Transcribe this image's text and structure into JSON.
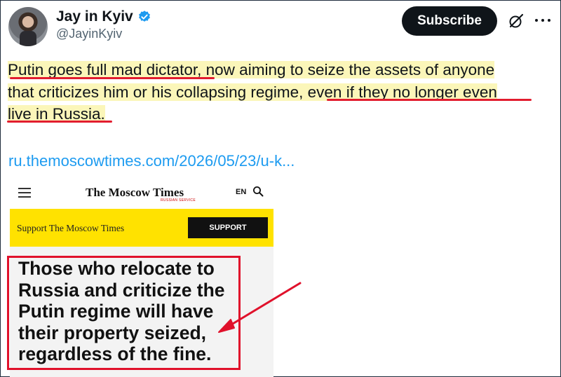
{
  "author": {
    "name": "Jay in Kyiv",
    "handle": "@JayinKyiv",
    "verified": true
  },
  "actions": {
    "subscribe_label": "Subscribe",
    "grok_icon": "grok-icon",
    "more_icon": "more-icon"
  },
  "tweet": {
    "line1_hl": "Putin goes full mad dictator,",
    "line1_rest": " now aiming to seize the assets of anyone",
    "line2_start": "that criticizes him or his collapsing regime, ",
    "line2_hl": "even if they no longer even",
    "line3_hl": "live in Russia.",
    "link": "ru.themoscowtimes.com/2026/05/23/u-k..."
  },
  "card": {
    "logo": "The Moscow Times",
    "logo_sub": "RUSSIAN SERVICE",
    "lang": "EN",
    "banner_text": "Support The Moscow Times",
    "support_label": "SUPPORT",
    "headline_lines": [
      "Those who relocate to",
      "Russia and criticize the",
      "Putin regime will have",
      "their property seized,",
      "regardless of the fine."
    ]
  },
  "colors": {
    "highlight": "#fbf6b9",
    "annotation_red": "#e21d2f",
    "link_blue": "#1d9bf0",
    "banner_yellow": "#ffe200",
    "verified_blue": "#1d9bf0"
  }
}
